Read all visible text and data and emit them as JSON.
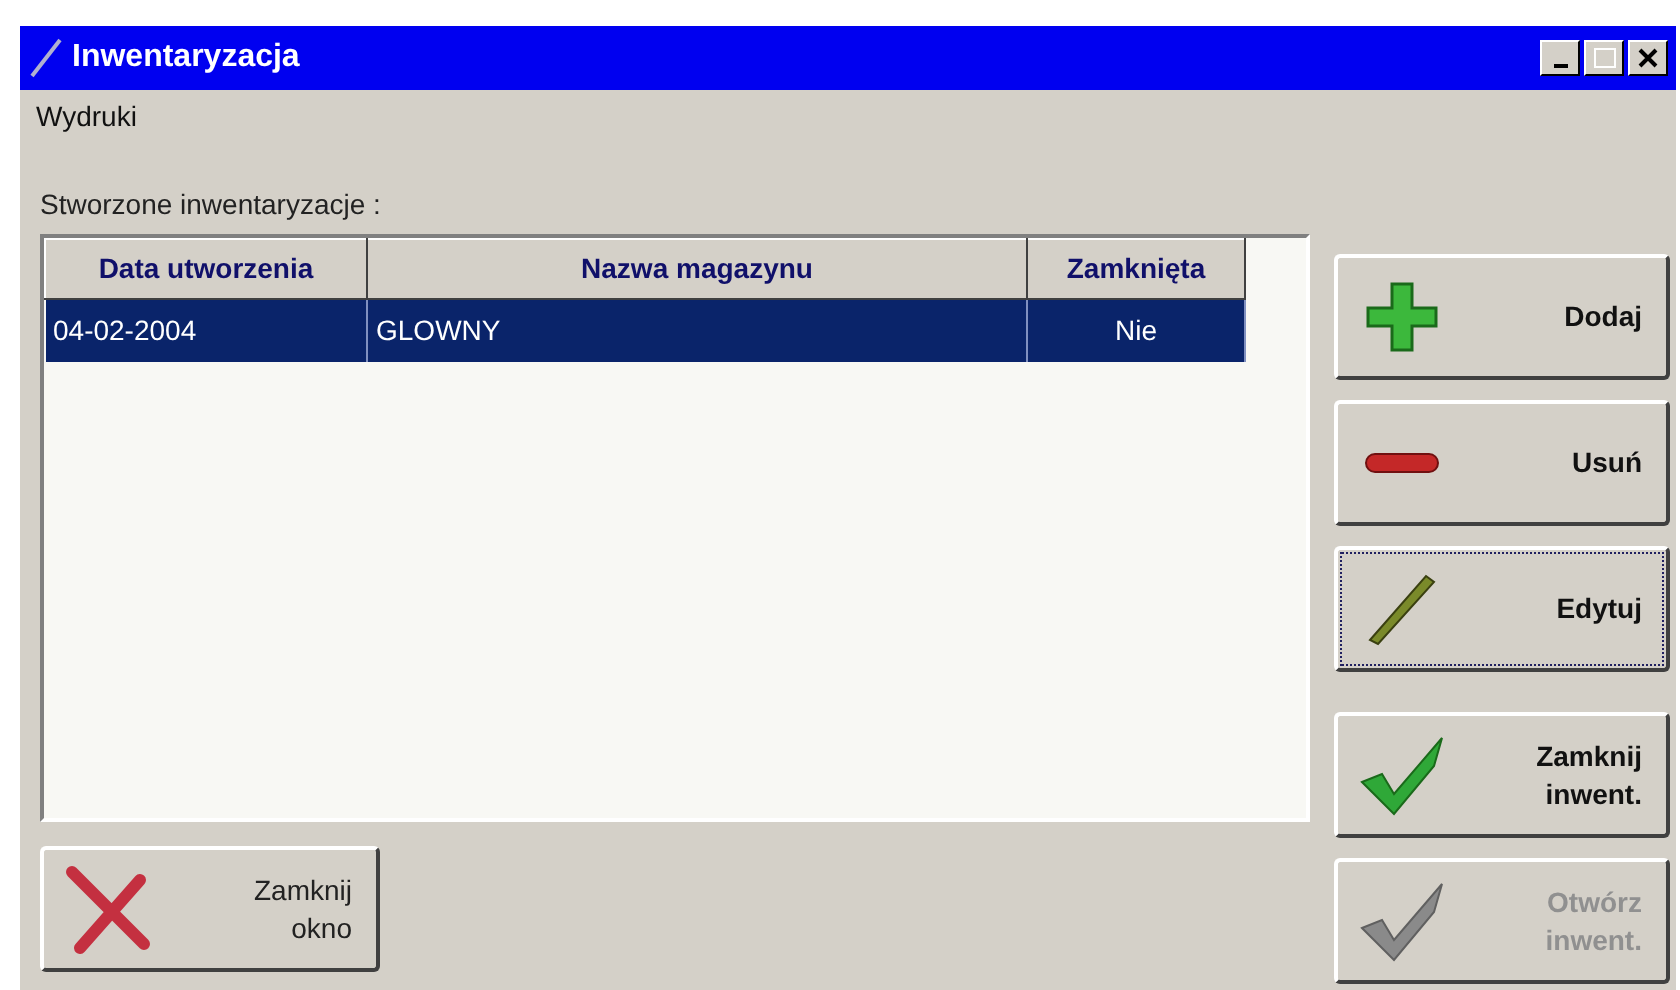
{
  "window": {
    "title": "Inwentaryzacja"
  },
  "menu": [
    "Wydruki"
  ],
  "list_label": "Stworzone inwentaryzacje :",
  "table": {
    "columns": [
      "Data utworzenia",
      "Nazwa magazynu",
      "Zamknięta"
    ],
    "rows": [
      {
        "cells": [
          "04-02-2004",
          "GLOWNY",
          "Nie"
        ],
        "selected": true
      }
    ]
  },
  "side_buttons": [
    {
      "kind": "plus",
      "lines": [
        "Dodaj"
      ],
      "disabled": false,
      "focused": false
    },
    {
      "kind": "minus",
      "lines": [
        "Usuń"
      ],
      "disabled": false,
      "focused": false
    },
    {
      "kind": "pen",
      "lines": [
        "Edytuj"
      ],
      "disabled": false,
      "focused": true
    },
    {
      "kind": "check",
      "lines": [
        "Zamknij",
        "inwent."
      ],
      "disabled": false,
      "focused": false
    },
    {
      "kind": "check",
      "lines": [
        "Otwórz",
        "inwent."
      ],
      "disabled": true,
      "focused": false
    }
  ],
  "close_button": {
    "kind": "cross",
    "lines": [
      "Zamknij",
      "okno"
    ],
    "disabled": false,
    "focused": false
  }
}
